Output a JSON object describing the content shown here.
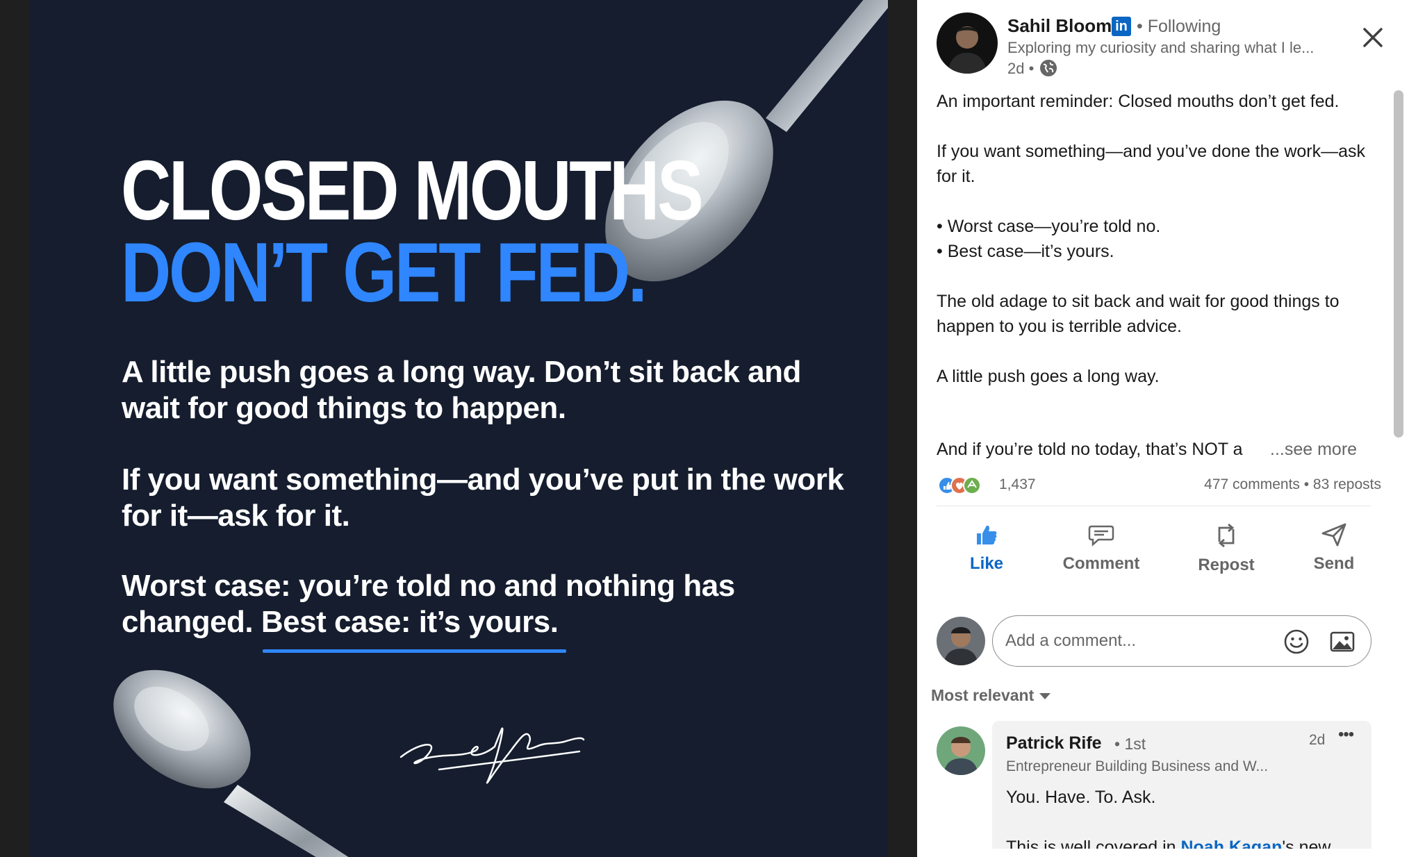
{
  "poster": {
    "headline_line1": "CLOSED MOUTHS",
    "headline_line2": "DON’T GET FED.",
    "para1": "A little push goes a long way. Don’t sit back and wait for good things to happen.",
    "para2": "If you want something—and you’ve put in the work for it—ask for it.",
    "para3_lead": "Worst case: you’re told no and nothing has changed. ",
    "para3_highlight": "Best case: it’s yours.",
    "colors": {
      "background": "#151d2e",
      "accent": "#2f86ff",
      "text": "#ffffff"
    },
    "icons": {
      "spoon_top": "spoon-illustration",
      "spoon_bottom": "spoon-illustration",
      "signature": "handwritten-signature"
    }
  },
  "author": {
    "name": "Sahil Bloom",
    "badge": "in",
    "follow_status": "• Following",
    "headline": "Exploring my curiosity and sharing what I le...",
    "time": "2d •"
  },
  "post": {
    "lines": [
      "An important reminder: Closed mouths don’t get fed.",
      "If you want something—and you’ve done the work—ask for it.",
      "• Worst case—you’re told no.",
      "• Best case—it’s yours.",
      "The old adage to sit back and wait for good things to happen to you is terrible advice.",
      "A little push goes a long way."
    ],
    "truncated_line": "And if you’re told no today, that’s NOT a",
    "see_more": "...see more"
  },
  "social": {
    "reaction_count": "1,437",
    "comments": "477 comments",
    "reposts": "• 83 reposts"
  },
  "actions": {
    "like": "Like",
    "comment": "Comment",
    "repost": "Repost",
    "send": "Send"
  },
  "composer": {
    "placeholder": "Add a comment..."
  },
  "sort": {
    "label": "Most relevant"
  },
  "comment": {
    "name": "Patrick Rife",
    "degree": "• 1st",
    "headline": "Entrepreneur Building Business and W...",
    "time": "2d",
    "more": "•••",
    "text": "You. Have. To. Ask.",
    "text2_lead": "This is well covered in ",
    "text2_link": "Noah Kagan",
    "text2_tail": "'s new"
  },
  "colors": {
    "linkedin_blue": "#0a66c2",
    "muted_text": "#666666"
  }
}
